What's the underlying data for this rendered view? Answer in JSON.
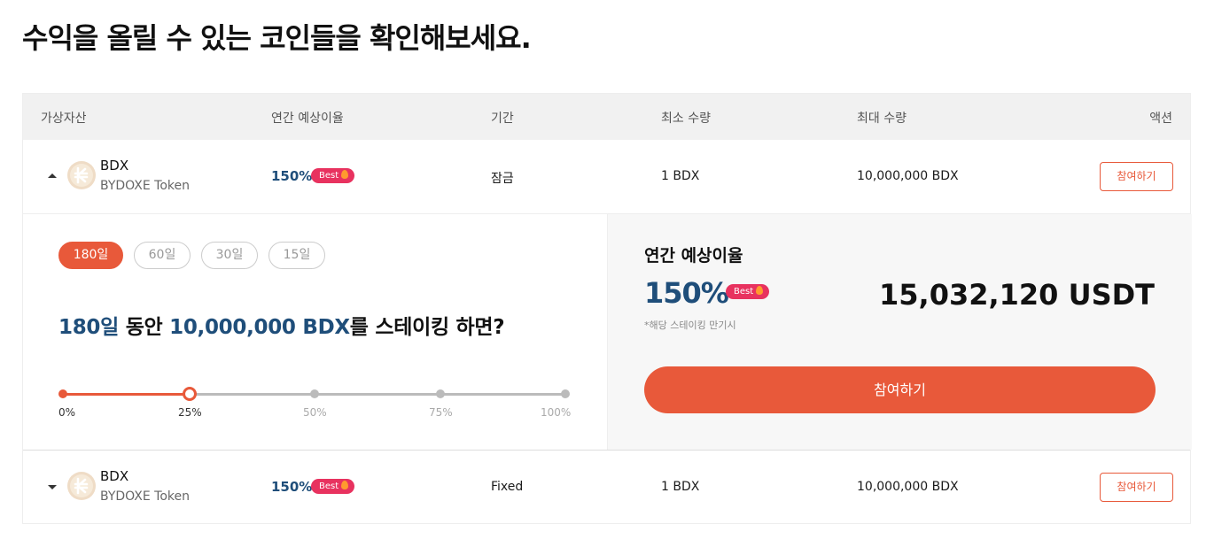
{
  "page": {
    "title": "수익을 올릴 수 있는 코인들을 확인해보세요."
  },
  "table": {
    "headers": {
      "asset": "가상자산",
      "apy": "연간 예상이율",
      "period": "기간",
      "min": "최소 수량",
      "max": "최대 수량",
      "action": "액션"
    },
    "rows": [
      {
        "symbol": "BDX",
        "name": "BYDOXE Token",
        "apy": "150%",
        "badge": "Best",
        "period": "잠금",
        "min": "1 BDX",
        "max": "10,000,000 BDX",
        "action_label": "참여하기",
        "expanded": true
      },
      {
        "symbol": "BDX",
        "name": "BYDOXE Token",
        "apy": "150%",
        "badge": "Best",
        "period": "Fixed",
        "min": "1 BDX",
        "max": "10,000,000 BDX",
        "action_label": "참여하기",
        "expanded": false
      }
    ]
  },
  "detail": {
    "periods": [
      "180일",
      "60일",
      "30일",
      "15일"
    ],
    "selected_period": "180일",
    "headline": {
      "period": "180일",
      "mid": " 동안 ",
      "amount": "10,000,000 BDX",
      "tail": "를 스테이킹 하면?"
    },
    "slider": {
      "value_percent": 25,
      "ticks": [
        "0%",
        "25%",
        "50%",
        "75%",
        "100%"
      ]
    },
    "summary": {
      "label": "연간 예상이율",
      "apy": "150%",
      "badge": "Best",
      "note": "*해당 스테이킹 만기시",
      "total": "15,032,120 USDT",
      "button_label": "참여하기"
    }
  },
  "colors": {
    "accent": "#e8593a",
    "highlight": "#1f4e7a",
    "badge": "#e8325f",
    "coin": "#efdcc6"
  },
  "icons": {
    "coin_logo": "bydoxe-coin-icon",
    "best_badge": "fire-icon",
    "expand_open": "caret-up-icon",
    "expand_closed": "caret-down-icon"
  }
}
